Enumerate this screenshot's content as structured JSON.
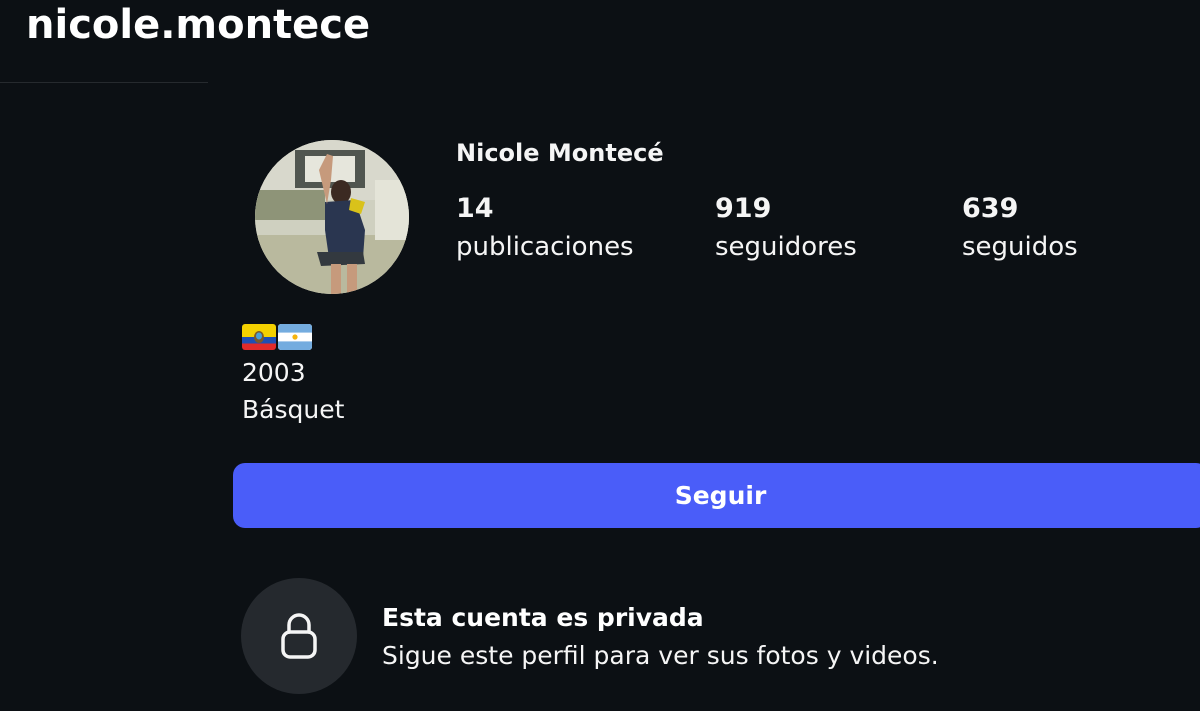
{
  "profile": {
    "username": "nicole.montece",
    "display_name": "Nicole Montecé",
    "avatar": "basketball-player-photo"
  },
  "stats": [
    {
      "value": "14",
      "label": "publicaciones"
    },
    {
      "value": "919",
      "label": "seguidores"
    },
    {
      "value": "639",
      "label": "seguidos"
    }
  ],
  "bio": {
    "flags": [
      "flag-ecuador-icon",
      "flag-argentina-icon"
    ],
    "line1": "2003",
    "line2": "Básquet"
  },
  "actions": {
    "follow_label": "Seguir"
  },
  "private_notice": {
    "icon": "lock-icon",
    "title": "Esta cuenta es privada",
    "subtitle": "Sigue este perfil para ver sus fotos y videos."
  },
  "colors": {
    "background": "#0c1014",
    "accent": "#4a5df9",
    "lock_circle": "#25292e"
  }
}
